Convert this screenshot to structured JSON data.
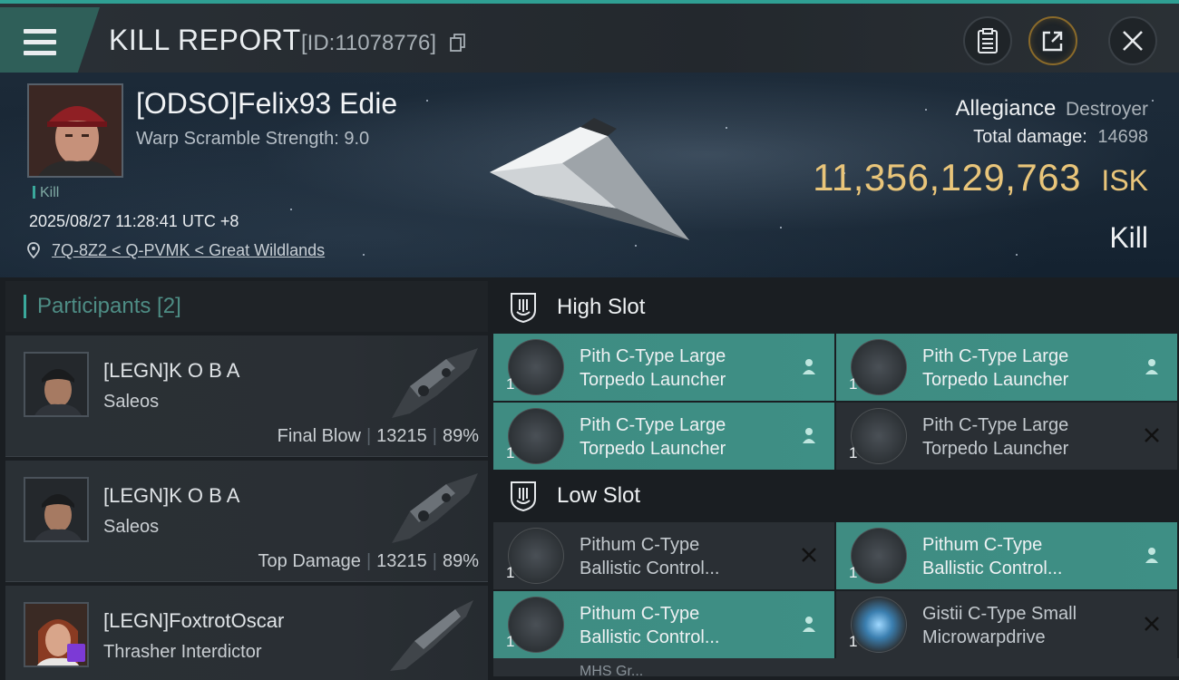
{
  "topbar": {
    "title": "KILL REPORT",
    "report_id": "[ID:11078776]"
  },
  "victim": {
    "name": "[ODSO]Felix93 Edie",
    "warp": "Warp Scramble Strength: 9.0",
    "tag": "Kill",
    "datetime": "2025/08/27 11:28:41 UTC +8",
    "location": "7Q-8Z2 < Q-PVMK < Great Wildlands"
  },
  "summary": {
    "ship_name": "Allegiance",
    "ship_class": "Destroyer",
    "total_damage_label": "Total damage:",
    "total_damage": "14698",
    "isk_value": "11,356,129,763",
    "isk_unit": "ISK",
    "result": "Kill"
  },
  "participants": {
    "header": "Participants [2]",
    "list": [
      {
        "name": "[LEGN]K O B A",
        "ship": "Saleos",
        "role": "Final Blow",
        "damage": "13215",
        "percent": "89%"
      },
      {
        "name": "[LEGN]K O B A",
        "ship": "Saleos",
        "role": "Top Damage",
        "damage": "13215",
        "percent": "89%"
      },
      {
        "name": "[LEGN]FoxtrotOscar",
        "ship": "Thrasher Interdictor"
      }
    ]
  },
  "slots": {
    "high": {
      "label": "High Slot",
      "items": [
        {
          "name_1": "Pith C-Type Large",
          "name_2": "Torpedo Launcher",
          "qty": "1",
          "status": "dropped"
        },
        {
          "name_1": "Pith C-Type Large",
          "name_2": "Torpedo Launcher",
          "qty": "1",
          "status": "dropped"
        },
        {
          "name_1": "Pith C-Type Large",
          "name_2": "Torpedo Launcher",
          "qty": "1",
          "status": "dropped"
        },
        {
          "name_1": "Pith C-Type Large",
          "name_2": "Torpedo Launcher",
          "qty": "1",
          "status": "destroyed"
        }
      ]
    },
    "low": {
      "label": "Low Slot",
      "items": [
        {
          "name_1": "Pithum C-Type",
          "name_2": "Ballistic Control...",
          "qty": "1",
          "status": "destroyed"
        },
        {
          "name_1": "Pithum C-Type",
          "name_2": "Ballistic Control...",
          "qty": "1",
          "status": "dropped"
        },
        {
          "name_1": "Pithum C-Type",
          "name_2": "Ballistic Control...",
          "qty": "1",
          "status": "dropped"
        },
        {
          "name_1": "Gistii C-Type Small",
          "name_2": "Microwarpdrive",
          "qty": "1",
          "status": "destroyed"
        }
      ],
      "partial_text": "MHS Gr..."
    }
  },
  "colors": {
    "accent": "#3aa89b",
    "isk": "#e9c57a",
    "dropped_bg": "#3f8c82"
  }
}
